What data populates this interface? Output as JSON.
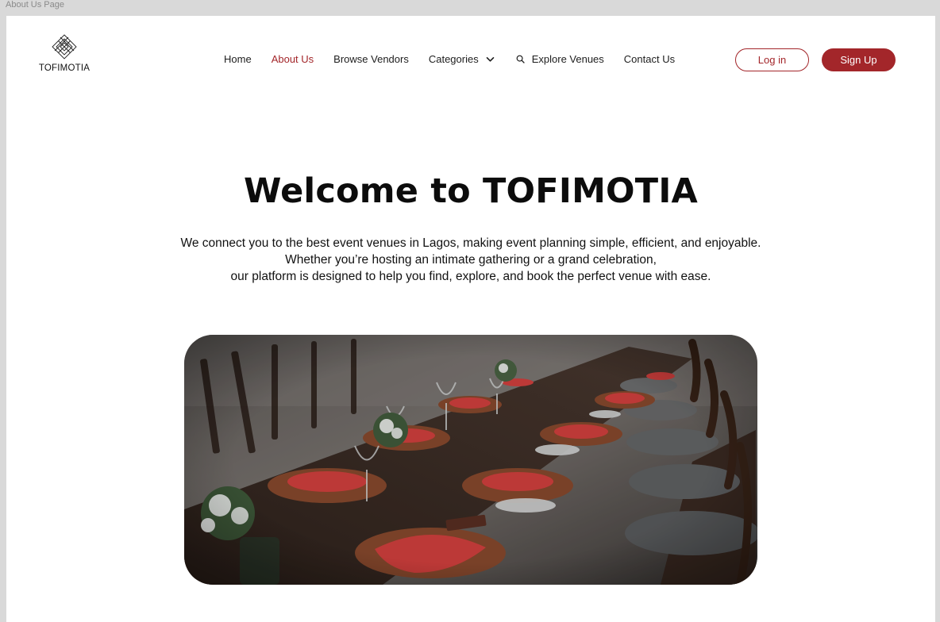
{
  "frame_label": "About Us Page",
  "brand": {
    "name": "TOFIMOTIA",
    "logo_icon": "diamond-lattice-icon",
    "accent_color": "#a3262a"
  },
  "nav": {
    "items": [
      {
        "label": "Home",
        "active": false
      },
      {
        "label": "About Us",
        "active": true
      },
      {
        "label": "Browse Vendors",
        "active": false
      },
      {
        "label": "Categories",
        "active": false,
        "icon": "chevron-down-icon"
      },
      {
        "label": "Explore Venues",
        "active": false,
        "icon": "search-icon"
      },
      {
        "label": "Contact Us",
        "active": false
      }
    ]
  },
  "auth": {
    "login_label": "Log in",
    "signup_label": "Sign Up"
  },
  "hero": {
    "title": "Welcome to TOFIMOTIA",
    "lines": [
      "We connect you to the best event venues in Lagos, making event planning simple, efficient, and enjoyable.",
      "Whether you’re hosting an intimate gathering or a grand celebration,",
      "our platform is designed to help you find, explore, and book the perfect venue with ease."
    ],
    "image_alt": "Long banquet table set with red napkins, wicker chargers, wine glasses and white flower arrangements beside dark wooden chairs"
  }
}
